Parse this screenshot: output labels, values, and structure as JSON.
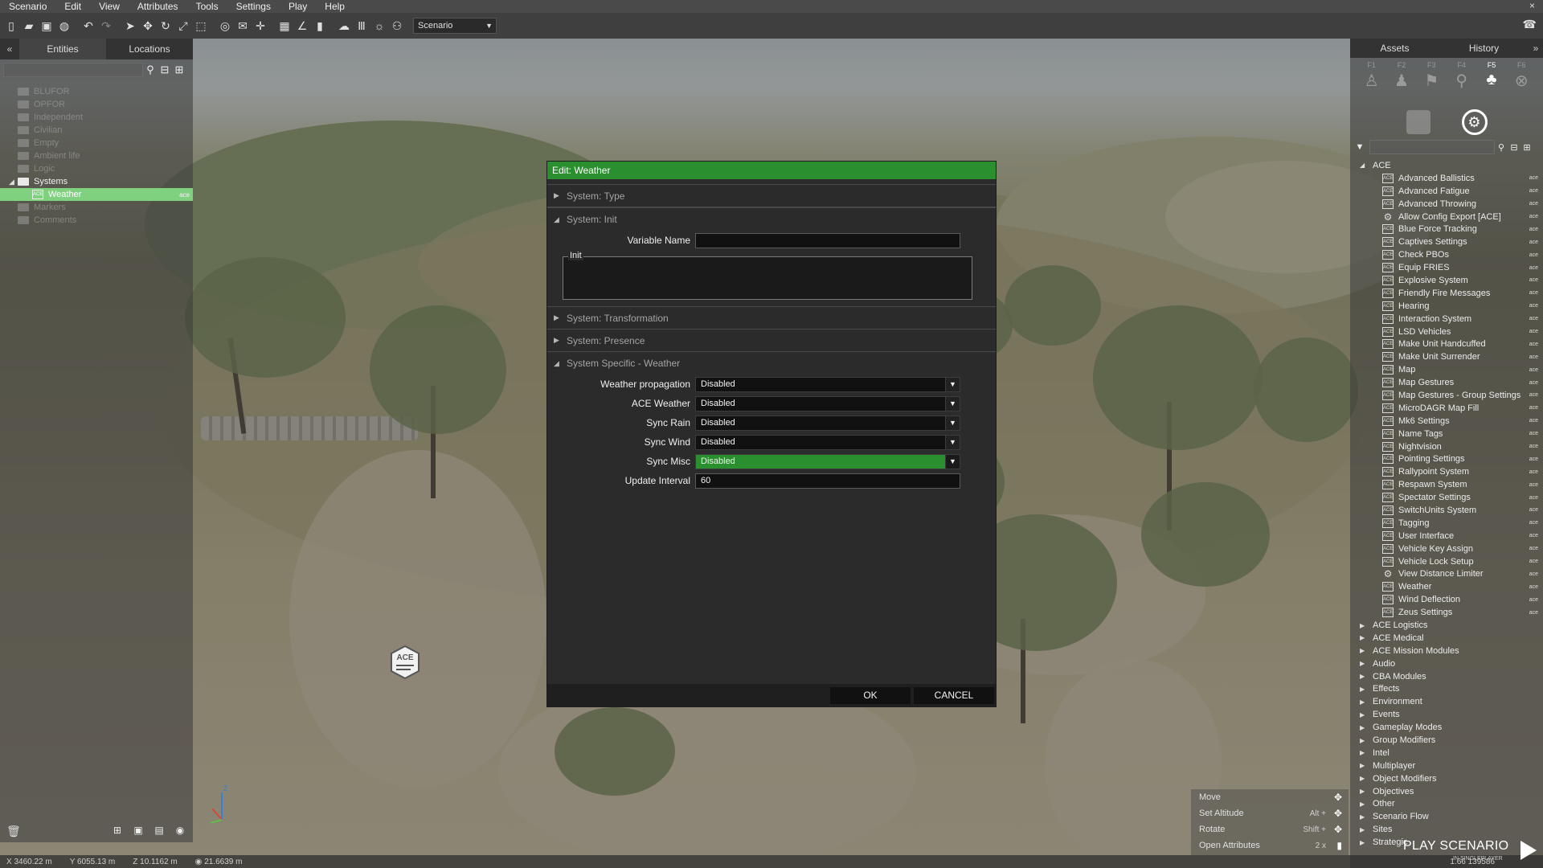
{
  "menubar": {
    "items": [
      "Scenario",
      "Edit",
      "View",
      "Attributes",
      "Tools",
      "Settings",
      "Play",
      "Help"
    ],
    "close_glyph": "×"
  },
  "toolbar": {
    "scenario_select": "Scenario",
    "icons": [
      "new-icon",
      "open-icon",
      "save-icon",
      "publish-icon",
      "undo-icon",
      "redo-icon",
      "select-icon",
      "move-icon",
      "rotate-icon",
      "scale-icon",
      "area-icon",
      "map-icon",
      "waypoint-icon",
      "place-icon",
      "grid-icon",
      "vertical-icon",
      "snap-icon",
      "weather-icon",
      "lights-icon",
      "camera-icon"
    ]
  },
  "left_panel": {
    "collapse_glyph": "«",
    "tabs": [
      "Entities",
      "Locations"
    ],
    "tree": [
      {
        "label": "BLUFOR",
        "dim": true
      },
      {
        "label": "OPFOR",
        "dim": true
      },
      {
        "label": "Independent",
        "dim": true
      },
      {
        "label": "Civilian",
        "dim": true
      },
      {
        "label": "Empty",
        "dim": true
      },
      {
        "label": "Ambient life",
        "dim": true
      },
      {
        "label": "Logic",
        "dim": true
      },
      {
        "label": "Systems",
        "dim": false
      },
      {
        "label": "Weather",
        "dim": false,
        "selected": true,
        "tag": "ace"
      },
      {
        "label": "Markers",
        "dim": true
      },
      {
        "label": "Comments",
        "dim": true
      }
    ]
  },
  "right_panel": {
    "tabs": [
      "Assets",
      "History"
    ],
    "expand_glyph": "»",
    "fkeys": [
      "F1",
      "F2",
      "F3",
      "F4",
      "F5",
      "F6"
    ],
    "active_fkey": "F5",
    "categories_before": [
      "ACE"
    ],
    "ace_modules": [
      "Advanced Ballistics",
      "Advanced Fatigue",
      "Advanced Throwing",
      "Allow Config Export [ACE]",
      "Blue Force Tracking",
      "Captives Settings",
      "Check PBOs",
      "Equip FRIES",
      "Explosive System",
      "Friendly Fire Messages",
      "Hearing",
      "Interaction System",
      "LSD Vehicles",
      "Make Unit Handcuffed",
      "Make Unit Surrender",
      "Map",
      "Map Gestures",
      "Map Gestures - Group Settings",
      "MicroDAGR Map Fill",
      "Mk6 Settings",
      "Name Tags",
      "Nightvision",
      "Pointing Settings",
      "Rallypoint System",
      "Respawn System",
      "Spectator Settings",
      "SwitchUnits System",
      "Tagging",
      "User Interface",
      "Vehicle Key Assign",
      "Vehicle Lock Setup",
      "View Distance Limiter",
      "Weather",
      "Wind Deflection",
      "Zeus Settings"
    ],
    "gear_modules": [
      "Allow Config Export [ACE]",
      "View Distance Limiter"
    ],
    "module_tag": "ace",
    "categories_after": [
      "ACE Logistics",
      "ACE Medical",
      "ACE Mission Modules",
      "Audio",
      "CBA Modules",
      "Effects",
      "Environment",
      "Events",
      "Gameplay Modes",
      "Group Modifiers",
      "Intel",
      "Multiplayer",
      "Object Modifiers",
      "Objectives",
      "Other",
      "Scenario Flow",
      "Sites",
      "Strategic"
    ]
  },
  "dialog": {
    "title": "Edit: Weather",
    "sections": {
      "type": "System: Type",
      "init": "System: Init",
      "transformation": "System: Transformation",
      "presence": "System: Presence",
      "specific": "System Specific - Weather"
    },
    "variable_name_label": "Variable Name",
    "variable_name_value": "",
    "init_label": "Init",
    "fields": [
      {
        "label": "Weather propagation",
        "value": "Disabled",
        "highlight": false
      },
      {
        "label": "ACE Weather",
        "value": "Disabled",
        "highlight": false
      },
      {
        "label": "Sync Rain",
        "value": "Disabled",
        "highlight": false
      },
      {
        "label": "Sync Wind",
        "value": "Disabled",
        "highlight": false
      },
      {
        "label": "Sync Misc",
        "value": "Disabled",
        "highlight": true
      }
    ],
    "update_interval_label": "Update Interval",
    "update_interval_value": "60",
    "ok_label": "OK",
    "cancel_label": "CANCEL"
  },
  "statusbar": {
    "x": "3460.22 m",
    "y": "6055.13 m",
    "z": "10.1162 m",
    "view": "21.6639 m",
    "zoom": "1.66 139586"
  },
  "hints": [
    {
      "label": "Move",
      "key": ""
    },
    {
      "label": "Set Altitude",
      "key": "Alt +"
    },
    {
      "label": "Rotate",
      "key": "Shift +"
    },
    {
      "label": "Open Attributes",
      "key": "2 x"
    }
  ],
  "play": {
    "label": "PLAY SCENARIO",
    "sub": "IN SINGLEPLAYER"
  },
  "world": {
    "ace_module_label": "ACE",
    "axis_label": "Z"
  },
  "colors": {
    "accent_green": "#2a8f2e",
    "selected_green": "#7fd07f",
    "panel_dark": "#2b2b2b"
  }
}
